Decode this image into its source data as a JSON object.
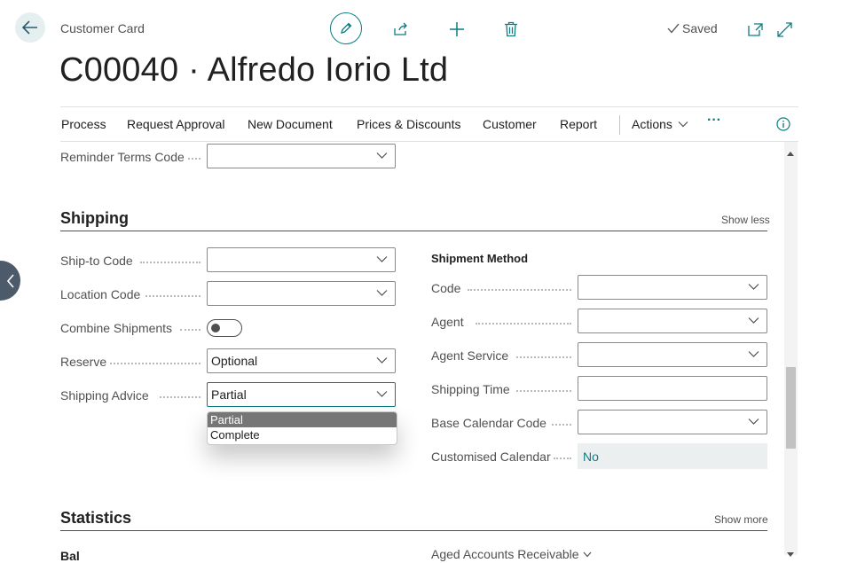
{
  "header": {
    "breadcrumb": "Customer Card",
    "title": "C00040 · Alfredo Iorio Ltd",
    "status": "Saved"
  },
  "actions": [
    "Process",
    "Request Approval",
    "New Document",
    "Prices & Discounts",
    "Customer",
    "Report",
    "Actions",
    "···"
  ],
  "reminder": {
    "label": "Reminder Terms Code",
    "value": ""
  },
  "shipping": {
    "title": "Shipping",
    "toggle_label": "Show less",
    "ship_to_code": {
      "label": "Ship-to Code",
      "value": ""
    },
    "location_code": {
      "label": "Location Code",
      "value": ""
    },
    "combine_shipments": {
      "label": "Combine Shipments",
      "on": false
    },
    "reserve": {
      "label": "Reserve",
      "value": "Optional"
    },
    "shipping_advice": {
      "label": "Shipping Advice",
      "value": "Partial",
      "options": [
        "Partial",
        "Complete"
      ]
    },
    "shipment_method": {
      "heading": "Shipment Method",
      "code": {
        "label": "Code",
        "value": ""
      },
      "agent": {
        "label": "Agent",
        "value": ""
      },
      "agent_service": {
        "label": "Agent Service",
        "value": ""
      }
    },
    "shipping_time": {
      "label": "Shipping Time",
      "value": ""
    },
    "base_calendar_code": {
      "label": "Base Calendar Code",
      "value": ""
    },
    "customised_calendar": {
      "label": "Customised Calendar",
      "value": "No"
    }
  },
  "statistics": {
    "title": "Statistics",
    "toggle_label": "Show more",
    "partial_left": "Bal",
    "partial_right": "Aged Accounts Receivable"
  },
  "colors": {
    "accent": "#0a7d83",
    "sidepanel_button": "#4d5a6a"
  }
}
